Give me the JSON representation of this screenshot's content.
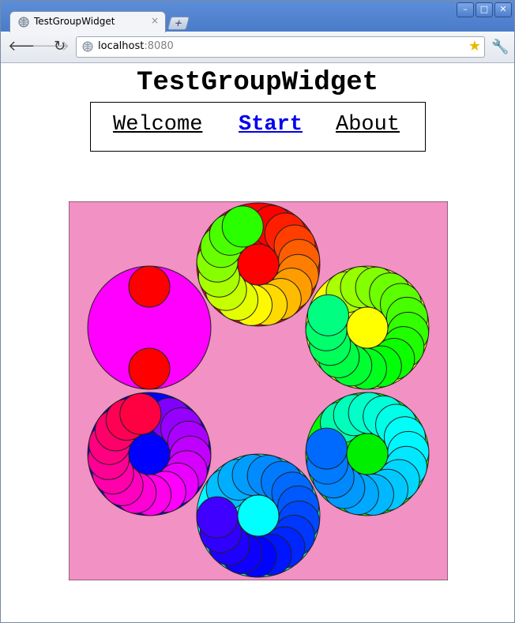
{
  "browser": {
    "tab_title": "TestGroupWidget",
    "tab_close": "×",
    "new_tab": "+",
    "url_host": "localhost",
    "url_port": ":8080",
    "window_controls": {
      "minimize": "–",
      "maximize": "□",
      "close": "✕"
    }
  },
  "page": {
    "title": "TestGroupWidget",
    "nav": {
      "welcome": "Welcome",
      "start": "Start",
      "about": "About"
    }
  },
  "canvas": {
    "background": "#f291c3"
  }
}
